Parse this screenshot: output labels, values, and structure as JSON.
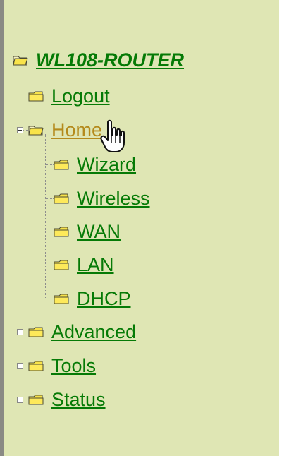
{
  "tree": {
    "root": {
      "label": "WL108-ROUTER"
    },
    "items": [
      {
        "label": "Logout"
      },
      {
        "label": "Home"
      },
      {
        "label": "Wizard"
      },
      {
        "label": "Wireless"
      },
      {
        "label": "WAN"
      },
      {
        "label": "LAN"
      },
      {
        "label": "DHCP"
      },
      {
        "label": "Advanced"
      },
      {
        "label": "Tools"
      },
      {
        "label": "Status"
      }
    ]
  },
  "icons": {
    "folder": "folder-icon",
    "open_folder": "open-folder-icon",
    "expand": "plus-box-icon",
    "collapse": "minus-box-icon",
    "cursor": "hand-pointer-icon"
  },
  "colors": {
    "background": "#dfe6b4",
    "link": "#067a06",
    "active_link": "#b48a1c"
  }
}
